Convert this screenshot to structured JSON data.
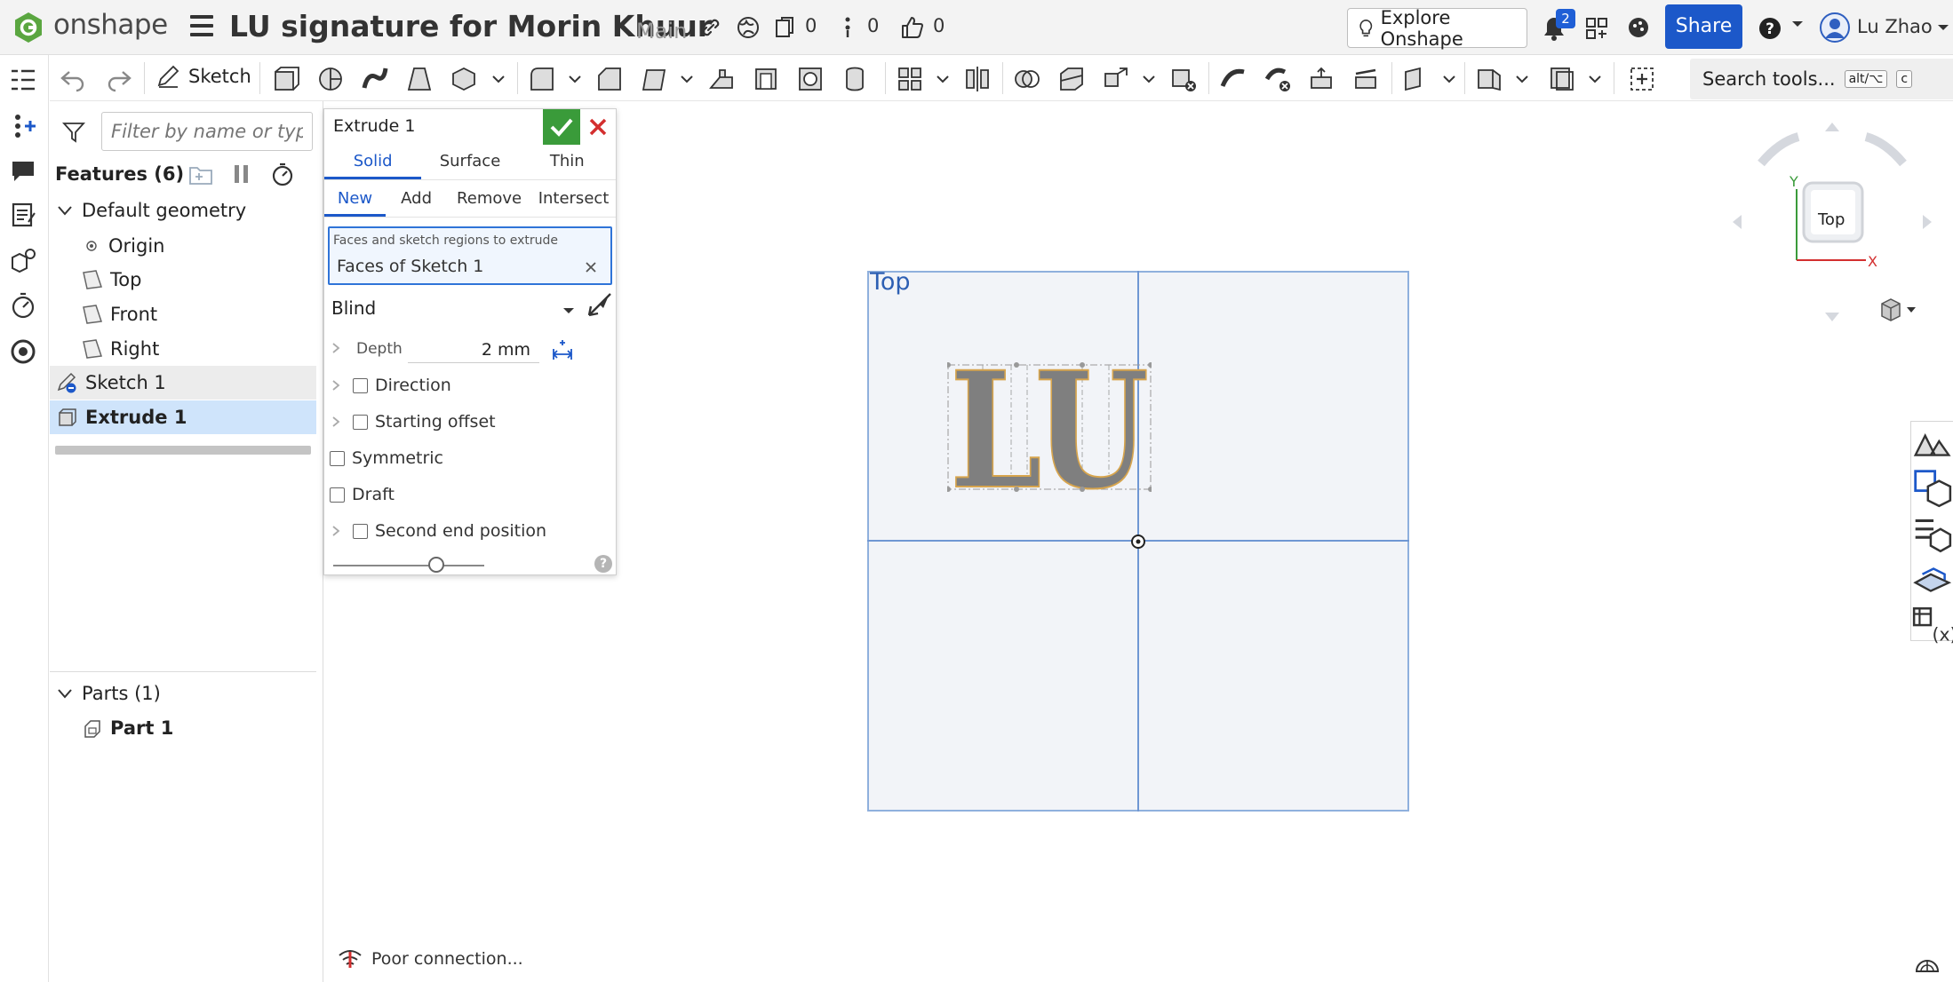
{
  "header": {
    "brand": "onshape",
    "doc_title": "LU signature for Morin Khuur",
    "branch": "Main",
    "versions_count": "0",
    "branches_count": "0",
    "likes_count": "0",
    "explore_label": "Explore Onshape",
    "notif_count": "2",
    "share_label": "Share",
    "user_name": "Lu Zhao"
  },
  "toolbar": {
    "sketch_label": "Sketch",
    "search_label": "Search tools...",
    "search_shortcut_1": "alt/⌥",
    "search_shortcut_2": "c"
  },
  "tree": {
    "filter_placeholder": "Filter by name or type",
    "features_header": "Features (6)",
    "default_geometry": "Default geometry",
    "origin": "Origin",
    "top": "Top",
    "front": "Front",
    "right": "Right",
    "sketch1": "Sketch 1",
    "extrude1": "Extrude 1",
    "parts_header": "Parts (1)",
    "part1": "Part 1"
  },
  "dialog": {
    "title": "Extrude 1",
    "tabs": [
      "Solid",
      "Surface",
      "Thin"
    ],
    "ops": [
      "New",
      "Add",
      "Remove",
      "Intersect"
    ],
    "faces_label": "Faces and sketch regions to extrude",
    "faces_value": "Faces of Sketch 1",
    "end_type": "Blind",
    "depth_label": "Depth",
    "depth_value": "2 mm",
    "direction": "Direction",
    "starting_offset": "Starting offset",
    "symmetric": "Symmetric",
    "draft": "Draft",
    "second_end": "Second end position",
    "help": "?"
  },
  "viewport": {
    "plane_label": "Top",
    "sketch_text": "LU",
    "cube_face": "Top",
    "axis_x": "X",
    "axis_y": "Y"
  },
  "status": {
    "message": "Poor connection..."
  },
  "colors": {
    "accent": "#1c58c9",
    "confirm_green": "#3a9b3a",
    "cancel_red": "#d32f2f",
    "selection": "#cfe4fb"
  }
}
